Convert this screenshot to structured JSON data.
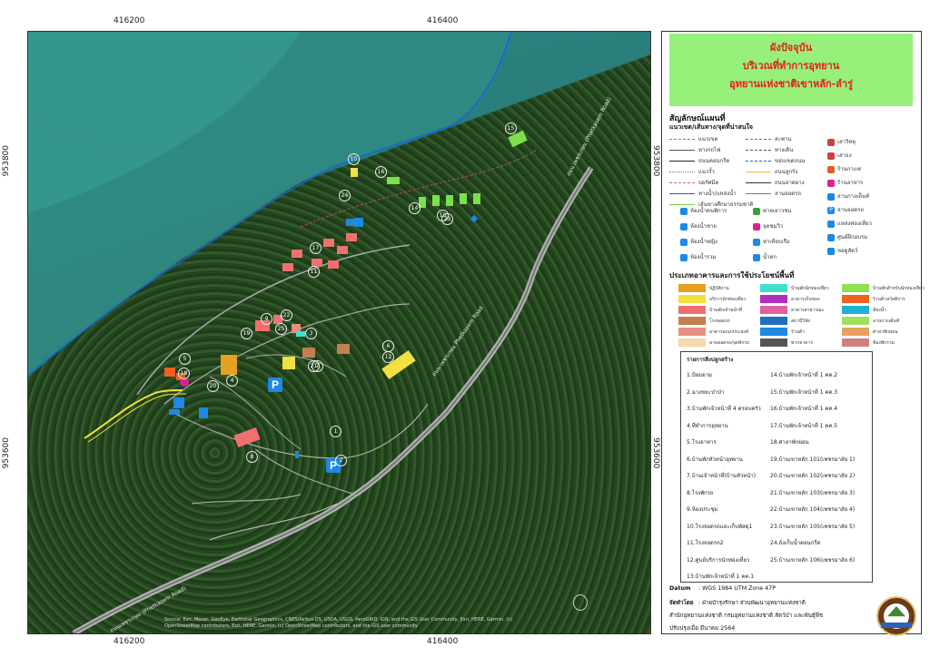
{
  "ticks": {
    "x_top": [
      "416200",
      "416400"
    ],
    "x_bottom": [
      "416200",
      "416400"
    ],
    "y_left": [
      "953800",
      "953600"
    ],
    "y_right": [
      "953800",
      "953600"
    ]
  },
  "map_labels": {
    "road_1": "ถนน เพชรเกษม (Phetkasem Road)",
    "road_2": "ถนน เพชรเกษม Phetkasem Road",
    "road_3": "ถนนเพชรเกษม (Phetkasem Road)",
    "attribution": "Source: Esri, Maxar, GeoEye, Earthstar Geographics, CNES/Airbus DS, USDA, USGS, AeroGRID, IGN, and the GIS User Community, Esri, HERE, Garmin, (c) OpenStreetMap contributors, Esri, HERE, Garmin, (c) OpenStreetMap contributors, and the GIS user community"
  },
  "title": {
    "line1": "ผังปัจจุบัน",
    "line2": "บริเวณที่ทำการอุทยาน",
    "line3": "อุทยานแห่งชาติเขาหลัก-ลำรู่"
  },
  "legend": {
    "heading": "สัญลักษณ์แผนที่",
    "subheading": "แนวเขต/เส้นทาง/จุดที่น่าสนใจ",
    "lines": [
      {
        "label": "แนวเขต",
        "color": "#d05a5a",
        "style": "dashed"
      },
      {
        "label": "ทางรถไฟ",
        "color": "#555555",
        "style": "solid"
      },
      {
        "label": "ถนนคอนกรีต",
        "color": "#222222",
        "style": "solid"
      },
      {
        "label": "แนวรั้ว",
        "color": "#777777",
        "style": "dotted"
      },
      {
        "label": "บ่อรัศมีต",
        "color": "#d07070",
        "style": "dashed"
      },
      {
        "label": "ทางน้ำ/แหล่งน้ำ",
        "color": "#1565c0",
        "style": "solid"
      },
      {
        "label": "เส้นทางศึกษาธรรมชาติ",
        "color": "#6fd23a",
        "style": "solid"
      }
    ],
    "lines2": [
      {
        "label": "สะพาน",
        "color": "#b05050",
        "style": "dashed"
      },
      {
        "label": "ทางเดิน",
        "color": "#555555",
        "style": "dashed"
      },
      {
        "label": "ขอบเขตถนน",
        "color": "#1565c0",
        "style": "dashed"
      },
      {
        "label": "ถนนลูกรัง",
        "color": "#f0c020",
        "style": "solid"
      },
      {
        "label": "ถนนลาดยาง",
        "color": "#333333",
        "style": "solid"
      },
      {
        "label": "ลานจอดรถ",
        "color": "#777777",
        "style": "solid"
      }
    ],
    "points_right": [
      {
        "label": "เสาวิทยุ",
        "color": "#d04040",
        "icon": "radio"
      },
      {
        "label": "เสาธง",
        "color": "#d04040",
        "icon": "flag"
      },
      {
        "label": "ร้านกาแฟ",
        "color": "#e06020",
        "icon": "cup"
      },
      {
        "label": "ร้านอาหาร",
        "color": "#e02090",
        "icon": "food"
      },
      {
        "label": "ลานกางเต็นท์",
        "color": "#1e88e5",
        "icon": "tent"
      },
      {
        "label": "ลานจอดรถ",
        "color": "#1e88e5",
        "icon": "P"
      },
      {
        "label": "แหล่งท่องเที่ยว",
        "color": "#1e88e5",
        "icon": "view"
      },
      {
        "label": "ศูนย์ฝึกอบรม",
        "color": "#1e88e5",
        "icon": "train"
      },
      {
        "label": "หอดูสัตว์",
        "color": "#1e88e5",
        "icon": "tower"
      }
    ],
    "points_left": [
      {
        "label": "ห้องน้ำคนพิการ",
        "color": "#1e88e5",
        "icon": "wheel"
      },
      {
        "label": "ห้องน้ำชาย",
        "color": "#1e88e5",
        "icon": "man"
      },
      {
        "label": "ห้องน้ำหญิง",
        "color": "#1e88e5",
        "icon": "woman"
      },
      {
        "label": "ห้องน้ำรวม",
        "color": "#1e88e5",
        "icon": "wc"
      }
    ],
    "points_mid": [
      {
        "label": "ค่ายเยาวชน",
        "color": "#3aa13a",
        "icon": "camp"
      },
      {
        "label": "จุดชมวิว",
        "color": "#e02090",
        "icon": "view"
      },
      {
        "label": "ท่าเทียบเรือ",
        "color": "#1e88e5",
        "icon": "boat"
      },
      {
        "label": "น้ำตก",
        "color": "#1e88e5",
        "icon": "fall"
      }
    ],
    "buildings_heading": "ประเภทอาคารและการใช้ประโยชน์พื้นที่",
    "building_types": [
      {
        "label": "ปฏิบัติงาน",
        "color": "#e8a020"
      },
      {
        "label": "บริการนักท่องเที่ยว",
        "color": "#f0e040"
      },
      {
        "label": "บ้านพักเจ้าหน้าที่",
        "color": "#f07070"
      },
      {
        "label": "โรงจอดรถ",
        "color": "#c08050"
      },
      {
        "label": "อาคารอเนกประสงค์",
        "color": "#e89080"
      },
      {
        "label": "ลานจอดรถ/จุดพักรถ",
        "color": "#f8d8a8"
      },
      {
        "label": "บ้านพักนักท่องเที่ยว",
        "color": "#40e0d0"
      },
      {
        "label": "อาคารเก็บของ",
        "color": "#b030c0"
      },
      {
        "label": "อาคารสาธารณะ",
        "color": "#e060a0"
      },
      {
        "label": "สถานีวิจัย",
        "color": "#2070c0"
      },
      {
        "label": "ร้านค้า",
        "color": "#1e88e5"
      },
      {
        "label": "ซากอาคาร",
        "color": "#555555"
      },
      {
        "label": "บ้านพักสำหรับนักท่องเที่ยว",
        "color": "#90e050"
      },
      {
        "label": "ร้านค้าสวัสดิการ",
        "color": "#f06020"
      },
      {
        "label": "ห้องน้ำ",
        "color": "#20b0d0"
      },
      {
        "label": "ลานกางเต็นท์",
        "color": "#a0e060"
      },
      {
        "label": "ศาลาพักผ่อน",
        "color": "#e8a060"
      },
      {
        "label": "ห้องพักรวม",
        "color": "#d08080"
      }
    ],
    "list_heading": "รายการสิ่งปลูกสร้าง",
    "list_col1": [
      "1.ป้อมยาม",
      "2.ฉางขยะป่าป่า",
      "3.บ้านพักเจ้าหน้าที่ 4 ครอบครัว",
      "4.ที่ทำการอุทยาน",
      "5.โรงอาหาร",
      "6.บ้านพักหัวหน้าอุทยาน",
      "7.บ้านเจ้าหน้าที่(บ้านหัวหน้า)",
      "8.โรงพักรถ",
      "9.ห้องประชุม",
      "10.โรงจอดรถและเก็บพัสดุ1",
      "11.โรงจอดรถ2",
      "12.ศูนย์บริการนักท่องเที่ยว",
      "13.บ้านพักเจ้าหน้าที่ 1 คค.1"
    ],
    "list_col2": [
      "14.บ้านพักเจ้าหน้าที่ 1 คค.2",
      "15.บ้านพักเจ้าหน้าที่ 1 คค.3",
      "16.บ้านพักเจ้าหน้าที่ 1 คค.4",
      "17.บ้านพักเจ้าหน้าที่ 1 คค.5",
      "18.ศาลาพักผ่อน",
      "19.บ้านเขาหลัก 101(เพชรมาลัย 1)",
      "20.บ้านเขาหลัก 102(เพชรมาลัย 2)",
      "21.บ้านเขาหลัก 103(เพชรมาลัย 3)",
      "22.บ้านเขาหลัก 104(เพชรมาลัย 4)",
      "23.บ้านเขาหลัก 105(เพชรมาลัย 5)",
      "24.ถังเก็บน้ำคอนกรีต",
      "25.บ้านเขาหลัก 106(เพชรมาลัย 6)"
    ],
    "datum_label": "Datum",
    "datum_value": ": WGS 1984 UTM Zone 47P",
    "made_by_label": "จัดทำโดย",
    "made_by_value": ": ฝ่ายบำรุงรักษา ส่วนพัฒนาอุทยานแห่งชาติ",
    "office": "สำนักอุทยานแห่งชาติ กรมอุทยานแห่งชาติ สัตว์ป่า และพันธุ์พืช",
    "updated": "ปรับปรุงเมื่อ มีนาคม 2564"
  },
  "site_numbers": [
    "1",
    "2",
    "3",
    "4",
    "5",
    "6",
    "7",
    "8",
    "9",
    "10",
    "11",
    "12",
    "13",
    "14",
    "15",
    "16",
    "17",
    "18",
    "19",
    "20",
    "21",
    "22",
    "23",
    "24",
    "25"
  ]
}
